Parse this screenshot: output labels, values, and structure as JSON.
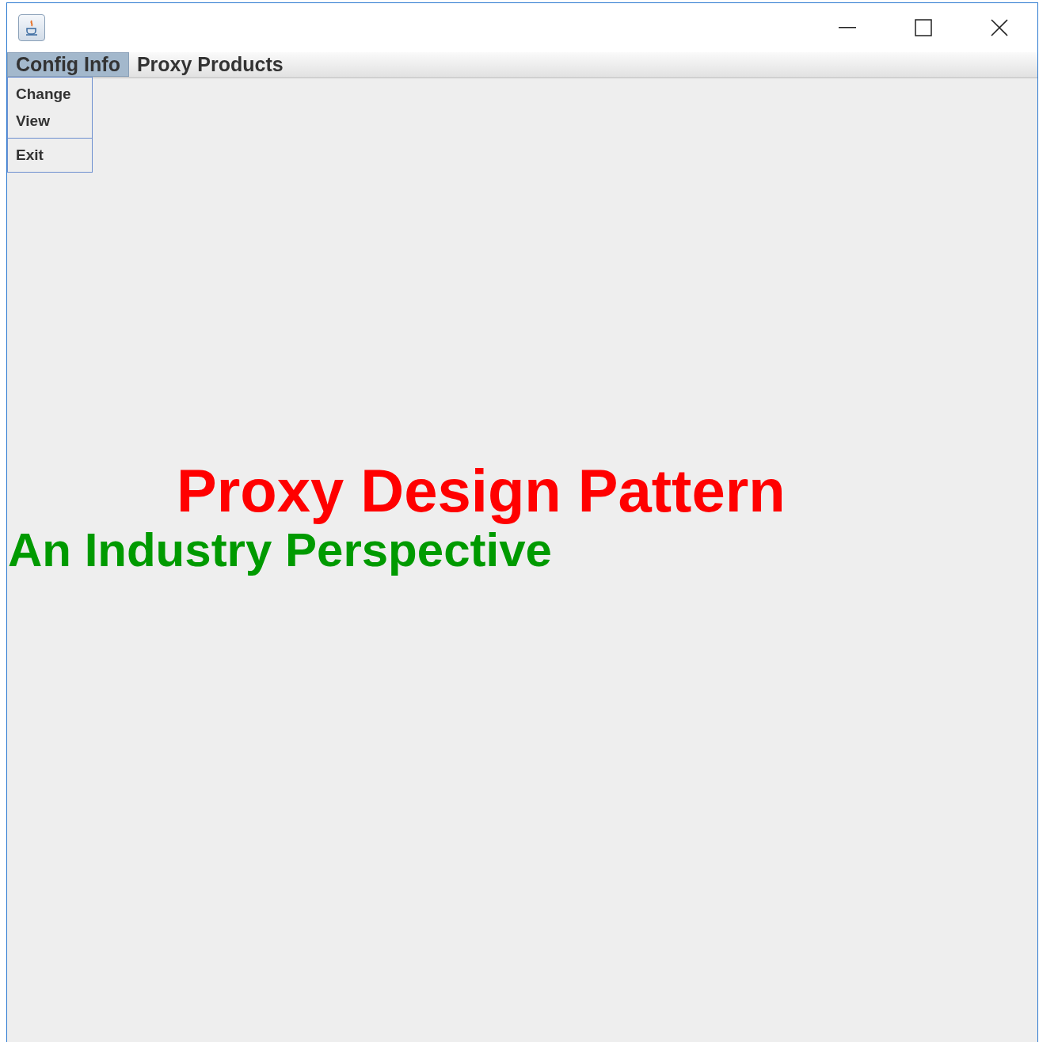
{
  "menu_bar": [
    {
      "label": "Config Info",
      "selected": true
    },
    {
      "label": "Proxy Products",
      "selected": false
    }
  ],
  "open_menu": {
    "items": [
      {
        "label": "Change",
        "separator_before": false
      },
      {
        "label": "View",
        "separator_before": false
      },
      {
        "label": "Exit",
        "separator_before": true
      }
    ]
  },
  "content": {
    "title": "Proxy Design Pattern",
    "subtitle": "An Industry Perspective"
  }
}
